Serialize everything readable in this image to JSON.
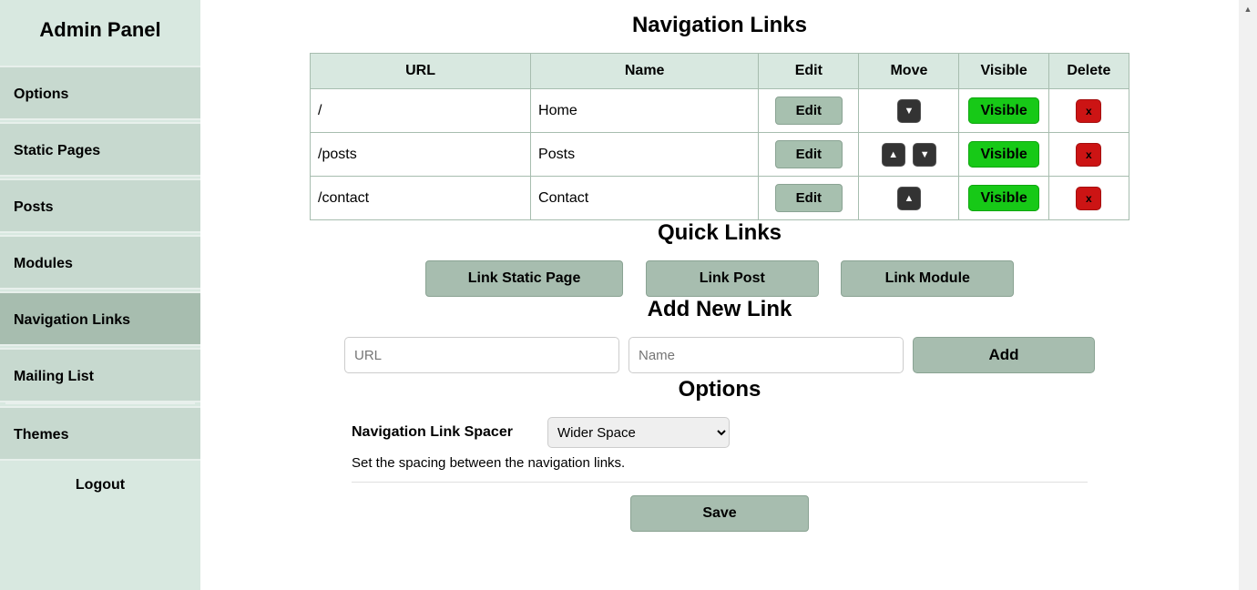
{
  "sidebar": {
    "brand": "Admin Panel",
    "items": [
      {
        "label": "Options",
        "active": false
      },
      {
        "label": "Static Pages",
        "active": false
      },
      {
        "label": "Posts",
        "active": false
      },
      {
        "label": "Modules",
        "active": false
      },
      {
        "label": "Navigation Links",
        "active": true
      },
      {
        "label": "Mailing List",
        "active": false
      },
      {
        "label": "Themes",
        "active": false
      }
    ],
    "logout_label": "Logout"
  },
  "headings": {
    "navigation_links": "Navigation Links",
    "quick_links": "Quick Links",
    "add_new_link": "Add New Link",
    "options": "Options"
  },
  "table": {
    "headers": {
      "url": "URL",
      "name": "Name",
      "edit": "Edit",
      "move": "Move",
      "visible": "Visible",
      "delete": "Delete"
    },
    "edit_label": "Edit",
    "visible_label": "Visible",
    "delete_label": "x",
    "rows": [
      {
        "url": "/",
        "name": "Home",
        "move_up": false,
        "move_down": true
      },
      {
        "url": "/posts",
        "name": "Posts",
        "move_up": true,
        "move_down": true
      },
      {
        "url": "/contact",
        "name": "Contact",
        "move_up": true,
        "move_down": false
      }
    ]
  },
  "quick_links": {
    "link_static_page": "Link Static Page",
    "link_post": "Link Post",
    "link_module": "Link Module"
  },
  "add_form": {
    "url_placeholder": "URL",
    "name_placeholder": "Name",
    "add_label": "Add"
  },
  "options": {
    "spacer_label": "Navigation Link Spacer",
    "spacer_selected": "Wider Space",
    "spacer_description": "Set the spacing between the navigation links.",
    "save_label": "Save"
  }
}
